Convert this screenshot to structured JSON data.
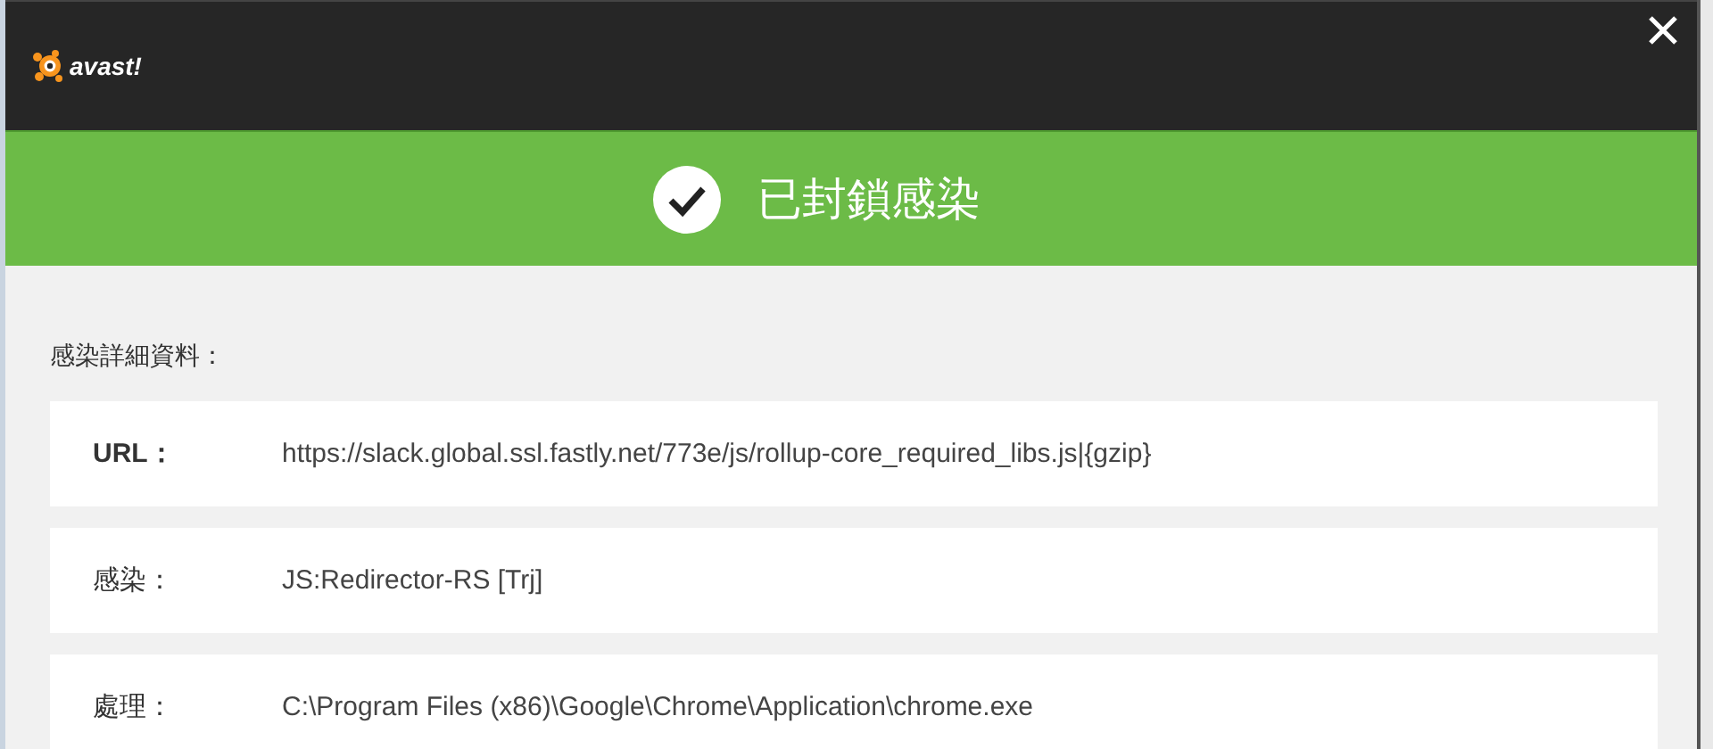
{
  "header": {
    "logo_text": "avast!"
  },
  "banner": {
    "title": "已封鎖感染"
  },
  "details": {
    "heading": "感染詳細資料：",
    "rows": [
      {
        "label": "URL：",
        "value": "https://slack.global.ssl.fastly.net/773e/js/rollup-core_required_libs.js|{gzip}"
      },
      {
        "label": "感染：",
        "value": "JS:Redirector-RS [Trj]"
      },
      {
        "label": "處理：",
        "value": "C:\\Program Files (x86)\\Google\\Chrome\\Application\\chrome.exe"
      }
    ]
  }
}
